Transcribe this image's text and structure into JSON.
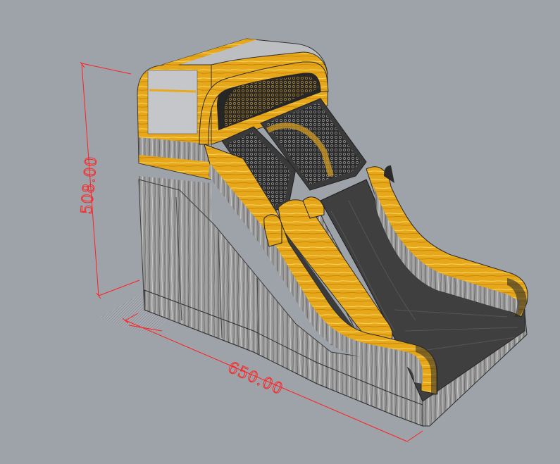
{
  "dimensions": {
    "height_label": "508.00",
    "width_label": "650.00"
  },
  "colors": {
    "background": "#9ea3a9",
    "yellow": "#e6a81a",
    "yellow_light": "#f4c54a",
    "gray_side": "#8e8e8e",
    "gray_light": "#c9c9cc",
    "slide_dark": "#3c3c3c",
    "dimension_red": "#ff2020"
  }
}
